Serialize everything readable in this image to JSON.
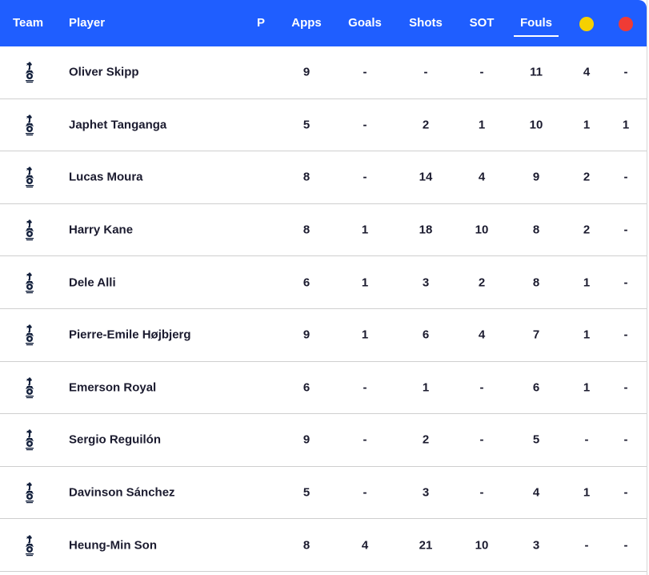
{
  "header": {
    "team": "Team",
    "player": "Player",
    "p": "P",
    "apps": "Apps",
    "goals": "Goals",
    "shots": "Shots",
    "sot": "SOT",
    "fouls": "Fouls",
    "yellow_card_color": "#f5d000",
    "red_card_color": "#ef3b35",
    "accent_color": "#1f5eff"
  },
  "team_icon": "tottenham-crest-icon",
  "rows": [
    {
      "player": "Oliver Skipp",
      "apps": "9",
      "goals": "-",
      "shots": "-",
      "sot": "-",
      "fouls": "11",
      "yellow": "4",
      "red": "-"
    },
    {
      "player": "Japhet Tanganga",
      "apps": "5",
      "goals": "-",
      "shots": "2",
      "sot": "1",
      "fouls": "10",
      "yellow": "1",
      "red": "1"
    },
    {
      "player": "Lucas Moura",
      "apps": "8",
      "goals": "-",
      "shots": "14",
      "sot": "4",
      "fouls": "9",
      "yellow": "2",
      "red": "-"
    },
    {
      "player": "Harry Kane",
      "apps": "8",
      "goals": "1",
      "shots": "18",
      "sot": "10",
      "fouls": "8",
      "yellow": "2",
      "red": "-"
    },
    {
      "player": "Dele Alli",
      "apps": "6",
      "goals": "1",
      "shots": "3",
      "sot": "2",
      "fouls": "8",
      "yellow": "1",
      "red": "-"
    },
    {
      "player": "Pierre-Emile Højbjerg",
      "apps": "9",
      "goals": "1",
      "shots": "6",
      "sot": "4",
      "fouls": "7",
      "yellow": "1",
      "red": "-"
    },
    {
      "player": "Emerson Royal",
      "apps": "6",
      "goals": "-",
      "shots": "1",
      "sot": "-",
      "fouls": "6",
      "yellow": "1",
      "red": "-"
    },
    {
      "player": "Sergio Reguilón",
      "apps": "9",
      "goals": "-",
      "shots": "2",
      "sot": "-",
      "fouls": "5",
      "yellow": "-",
      "red": "-"
    },
    {
      "player": "Davinson Sánchez",
      "apps": "5",
      "goals": "-",
      "shots": "3",
      "sot": "-",
      "fouls": "4",
      "yellow": "1",
      "red": "-"
    },
    {
      "player": "Heung-Min Son",
      "apps": "8",
      "goals": "4",
      "shots": "21",
      "sot": "10",
      "fouls": "3",
      "yellow": "-",
      "red": "-"
    }
  ]
}
